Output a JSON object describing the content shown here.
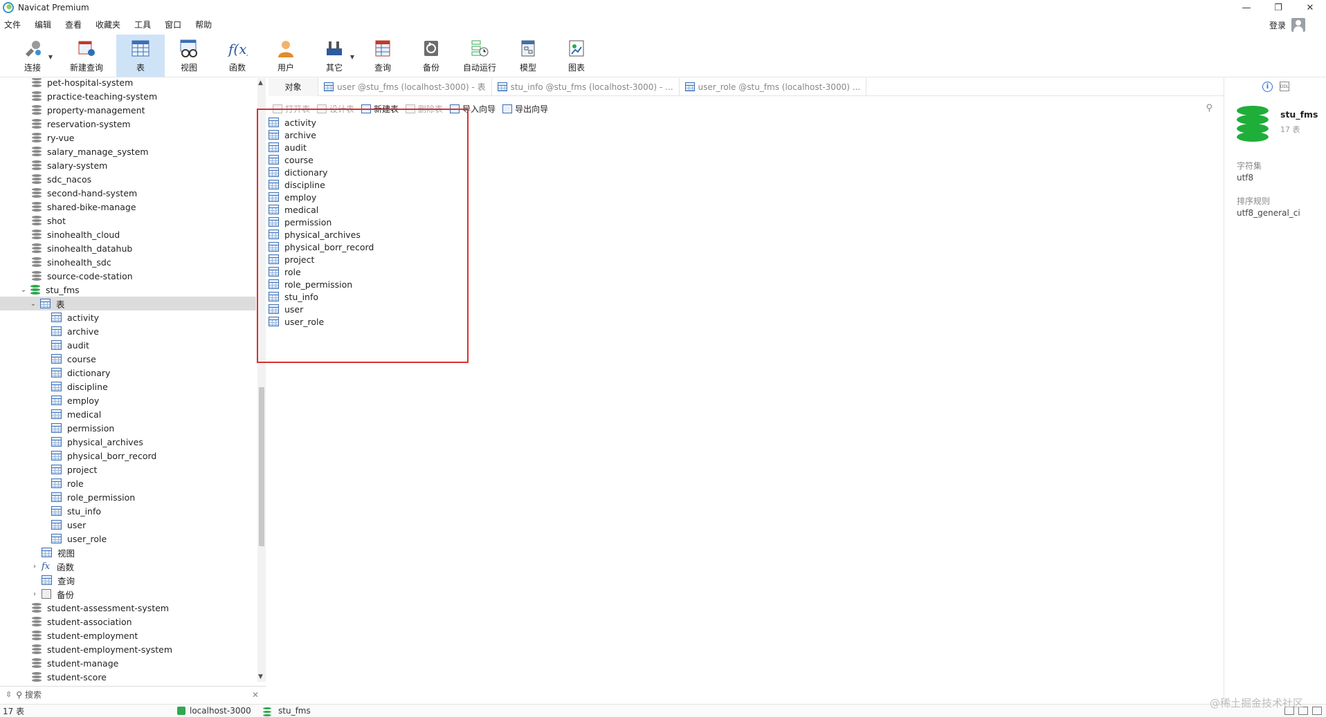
{
  "window": {
    "title": "Navicat Premium",
    "controls": [
      "—",
      "❐",
      "✕"
    ]
  },
  "menu": [
    "文件",
    "编辑",
    "查看",
    "收藏夹",
    "工具",
    "窗口",
    "帮助"
  ],
  "login_label": "登录",
  "toolbar": [
    {
      "label": "连接",
      "icon": "connect-icon"
    },
    {
      "label": "新建查询",
      "icon": "new-query-icon"
    },
    {
      "label": "表",
      "icon": "table-icon",
      "active": true
    },
    {
      "label": "视图",
      "icon": "view-icon"
    },
    {
      "label": "函数",
      "icon": "function-icon"
    },
    {
      "label": "用户",
      "icon": "user-icon"
    },
    {
      "label": "其它",
      "icon": "other-icon"
    },
    {
      "label": "查询",
      "icon": "query-icon"
    },
    {
      "label": "备份",
      "icon": "backup-icon"
    },
    {
      "label": "自动运行",
      "icon": "schedule-icon"
    },
    {
      "label": "模型",
      "icon": "model-icon"
    },
    {
      "label": "图表",
      "icon": "chart-icon"
    }
  ],
  "tree": {
    "databases_before": [
      "pet-hospital-system",
      "practice-teaching-system",
      "property-management",
      "reservation-system",
      "ry-vue",
      "salary_manage_system",
      "salary-system",
      "sdc_nacos",
      "second-hand-system",
      "shared-bike-manage",
      "shot",
      "sinohealth_cloud",
      "sinohealth_datahub",
      "sinohealth_sdc",
      "source-code-station"
    ],
    "open_db": "stu_fms",
    "tables_node": "表",
    "tables": [
      "activity",
      "archive",
      "audit",
      "course",
      "dictionary",
      "discipline",
      "employ",
      "medical",
      "permission",
      "physical_archives",
      "physical_borr_record",
      "project",
      "role",
      "role_permission",
      "stu_info",
      "user",
      "user_role"
    ],
    "other_nodes": [
      "视图",
      "函数",
      "查询",
      "备份"
    ],
    "databases_after": [
      "student-assessment-system",
      "student-association",
      "student-employment",
      "student-employment-system",
      "student-manage",
      "student-score"
    ],
    "search_placeholder": "搜索"
  },
  "tabs": [
    {
      "label": "对象"
    },
    {
      "label": "user @stu_fms (localhost-3000) - 表"
    },
    {
      "label": "stu_info @stu_fms (localhost-3000) - ..."
    },
    {
      "label": "user_role @stu_fms (localhost-3000) ..."
    }
  ],
  "object_toolbar": [
    {
      "label": "打开表",
      "enabled": false
    },
    {
      "label": "设计表",
      "enabled": false
    },
    {
      "label": "新建表",
      "enabled": true
    },
    {
      "label": "删除表",
      "enabled": false
    },
    {
      "label": "导入向导",
      "enabled": true
    },
    {
      "label": "导出向导",
      "enabled": true
    }
  ],
  "object_list": [
    "activity",
    "archive",
    "audit",
    "course",
    "dictionary",
    "discipline",
    "employ",
    "medical",
    "permission",
    "physical_archives",
    "physical_borr_record",
    "project",
    "role",
    "role_permission",
    "stu_info",
    "user",
    "user_role"
  ],
  "right_panel": {
    "db_name": "stu_fms",
    "table_count": "17 表",
    "charset_label": "字符集",
    "charset_value": "utf8",
    "collation_label": "排序规则",
    "collation_value": "utf8_general_ci",
    "ddl_icon_text": "DDL"
  },
  "status": {
    "count": "17 表",
    "connection": "localhost-3000",
    "database": "stu_fms"
  },
  "watermark": "@稀土掘金技术社区",
  "colors": {
    "accent": "#cfe3f7",
    "highlight_box": "#d8312f",
    "db_green": "#1fae3a"
  }
}
